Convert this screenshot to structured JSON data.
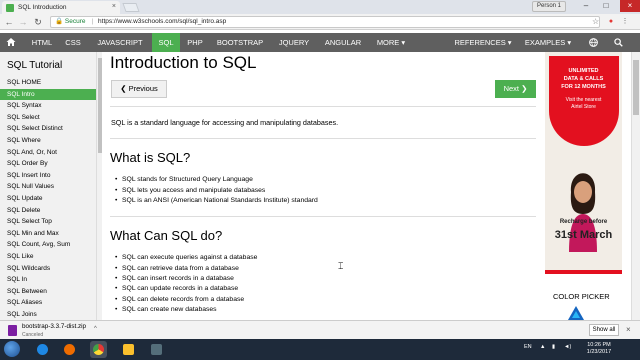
{
  "browser": {
    "tab_title": "SQL Introduction",
    "tab_close": "×",
    "profile_label": "Person 1",
    "secure_label": "Secure",
    "url": "https://www.w3schools.com/sql/sql_intro.asp",
    "window_controls": {
      "minimize": "–",
      "maximize": "□",
      "close": "×"
    },
    "nav_buttons": {
      "back": "←",
      "forward": "→",
      "reload": "↻"
    }
  },
  "topnav": {
    "home_icon": "home-icon",
    "items": [
      "HTML",
      "CSS",
      "JAVASCRIPT",
      "SQL",
      "PHP",
      "BOOTSTRAP",
      "JQUERY",
      "ANGULAR",
      "MORE ▾"
    ],
    "active": "SQL",
    "right_items": [
      "REFERENCES ▾",
      "EXAMPLES ▾"
    ]
  },
  "sidebar": {
    "title": "SQL Tutorial",
    "items": [
      "SQL HOME",
      "SQL Intro",
      "SQL Syntax",
      "SQL Select",
      "SQL Select Distinct",
      "SQL Where",
      "SQL And, Or, Not",
      "SQL Order By",
      "SQL Insert Into",
      "SQL Null Values",
      "SQL Update",
      "SQL Delete",
      "SQL Select Top",
      "SQL Min and Max",
      "SQL Count, Avg, Sum",
      "SQL Like",
      "SQL Wildcards",
      "SQL In",
      "SQL Between",
      "SQL Aliases",
      "SQL Joins"
    ],
    "active": "SQL Intro"
  },
  "main": {
    "title": "Introduction to SQL",
    "prev_label": "❮ Previous",
    "next_label": "Next ❯",
    "intro": "SQL is a standard language for accessing and manipulating databases.",
    "section1_title": "What is SQL?",
    "section1_items": [
      "SQL stands for Structured Query Language",
      "SQL lets you access and manipulate databases",
      "SQL is an ANSI (American National Standards Institute) standard"
    ],
    "section2_title": "What Can SQL do?",
    "section2_items": [
      "SQL can execute queries against a database",
      "SQL can retrieve data from a database",
      "SQL can insert records in a database",
      "SQL can update records in a database",
      "SQL can delete records from a database",
      "SQL can create new databases"
    ]
  },
  "ad": {
    "line1": "UNLIMITED",
    "line2": "DATA & CALLS",
    "line3": "FOR 12 MONTHS",
    "line4": "Visit the nearest",
    "line5": "Airtel Store",
    "recharge": "Recharge before",
    "date": "31st March"
  },
  "color_picker_label": "COLOR PICKER",
  "download": {
    "file_name": "bootstrap-3.3.7-dist.zip",
    "status": "Canceled",
    "show_all": "Show all",
    "close": "×"
  },
  "taskbar": {
    "lang": "EN",
    "time": "10:26 PM",
    "date": "1/23/2017"
  },
  "colors": {
    "accent": "#4caf50",
    "nav_bg": "#5f5f5f",
    "sidebar_bg": "#f1f1f1"
  }
}
